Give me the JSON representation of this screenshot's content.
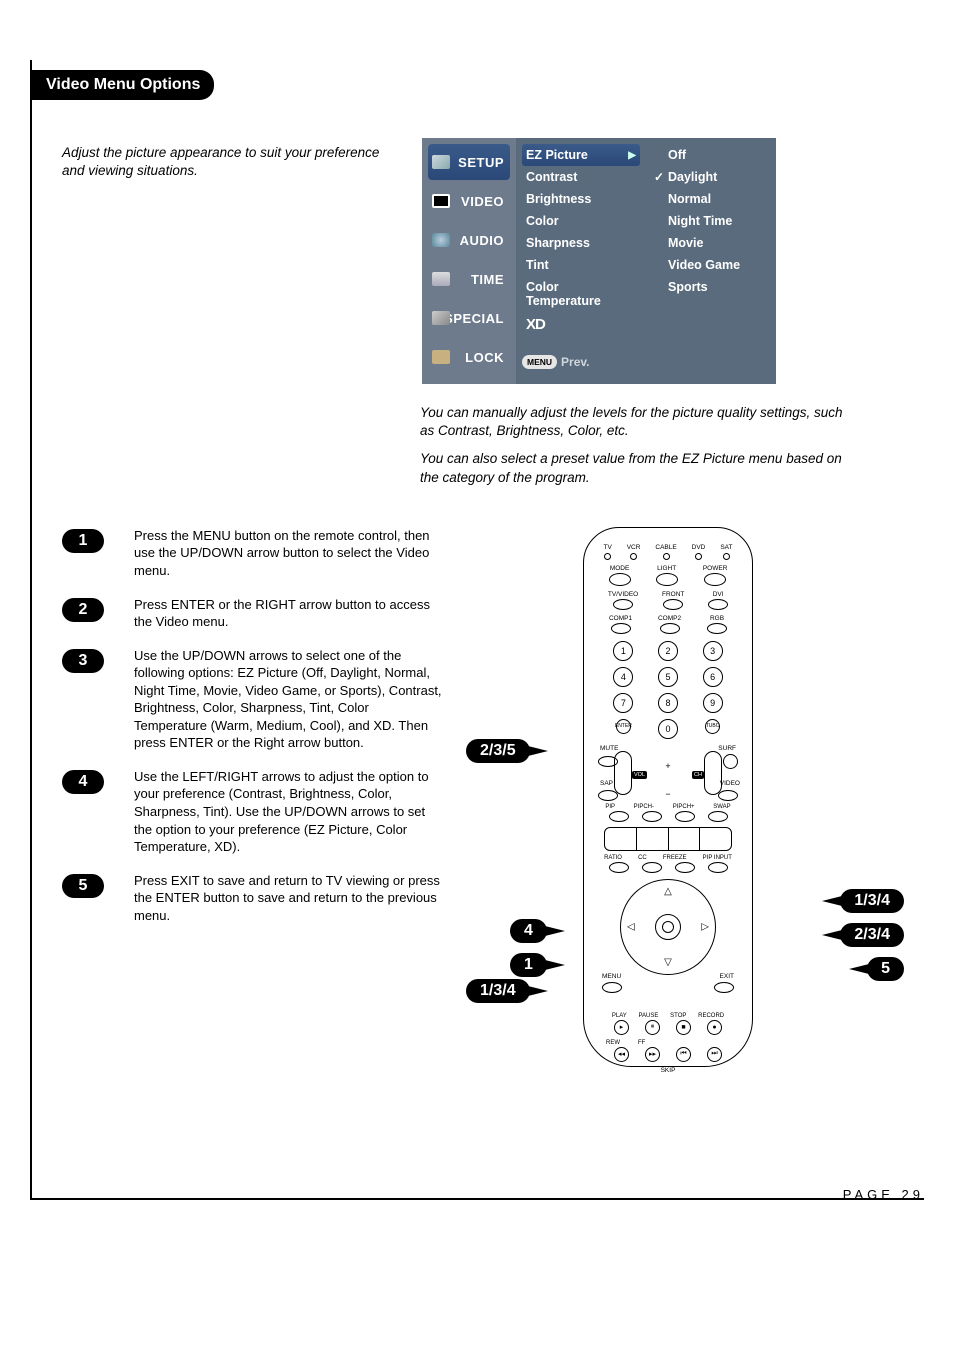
{
  "header": {
    "title": "Video Menu Options"
  },
  "intro": "Adjust the picture appearance to suit your preference and viewing situations.",
  "menu": {
    "tabs": [
      {
        "label": "SETUP"
      },
      {
        "label": "VIDEO"
      },
      {
        "label": "AUDIO"
      },
      {
        "label": "TIME"
      },
      {
        "label": "SPECIAL"
      },
      {
        "label": "LOCK"
      }
    ],
    "items": [
      {
        "label": "EZ Picture"
      },
      {
        "label": "Contrast"
      },
      {
        "label": "Brightness"
      },
      {
        "label": "Color"
      },
      {
        "label": "Sharpness"
      },
      {
        "label": "Tint"
      },
      {
        "label": "Color Temperature"
      }
    ],
    "xd": "XD",
    "prev_btn": "MENU",
    "prev_txt": "Prev.",
    "options": [
      {
        "label": "Off"
      },
      {
        "label": "Daylight"
      },
      {
        "label": "Normal"
      },
      {
        "label": "Night Time"
      },
      {
        "label": "Movie"
      },
      {
        "label": "Video Game"
      },
      {
        "label": "Sports"
      }
    ]
  },
  "caption1": "You can manually adjust the levels for the picture quality settings, such as Contrast, Brightness, Color, etc.",
  "caption2": "You can also select a preset value from the EZ Picture menu based on the category of the program.",
  "steps": [
    {
      "n": "1",
      "text": "Press the MENU button on the remote control, then use the UP/DOWN arrow button to select the Video menu."
    },
    {
      "n": "2",
      "text": "Press ENTER or the RIGHT arrow button to access the Video menu."
    },
    {
      "n": "3",
      "text": "Use the UP/DOWN arrows to select one of the following options: EZ Picture (Off, Daylight, Normal, Night Time, Movie, Video Game, or Sports), Contrast, Brightness, Color, Sharpness, Tint, Color Temperature (Warm, Medium, Cool), and XD. Then press ENTER or the Right arrow button."
    },
    {
      "n": "4",
      "text": "Use the LEFT/RIGHT arrows to adjust the option to your preference (Contrast, Brightness, Color, Sharpness, Tint). Use the UP/DOWN arrows to set the option to your preference (EZ Picture, Color Temperature, XD)."
    },
    {
      "n": "5",
      "text": "Press EXIT to save and return to TV viewing or press the ENTER button to save and return to the previous menu."
    }
  ],
  "remote": {
    "top": [
      "TV",
      "VCR",
      "CABLE",
      "DVD",
      "SAT"
    ],
    "row1": [
      "MODE",
      "LIGHT",
      "POWER"
    ],
    "row2": [
      "TV/VIDEO",
      "FRONT",
      "DVI"
    ],
    "row3": [
      "COMP1",
      "COMP2",
      "RGB"
    ],
    "enter": "ENTER",
    "tubo": "TUBO",
    "mute": "MUTE",
    "surf": "SURF",
    "sap": "SAP",
    "video": "VIDEO",
    "vol": "VOL",
    "ch": "CH",
    "piprow": [
      "PIP",
      "PIPCH-",
      "PIPCH+",
      "SWAP"
    ],
    "midrow": [
      "RATIO",
      "CC",
      "FREEZE",
      "PIP INPUT"
    ],
    "menu": "MENU",
    "exit": "EXIT",
    "transport1": [
      "PLAY",
      "PAUSE",
      "STOP",
      "RECORD"
    ],
    "transport2": [
      "REW",
      "FF"
    ],
    "skip": "SKIP"
  },
  "callouts": {
    "c235": "2/3/5",
    "c4": "4",
    "c1": "1",
    "c134_l": "1/3/4",
    "c134_r": "1/3/4",
    "c234": "2/3/4",
    "c5": "5"
  },
  "page": "PAGE 29"
}
